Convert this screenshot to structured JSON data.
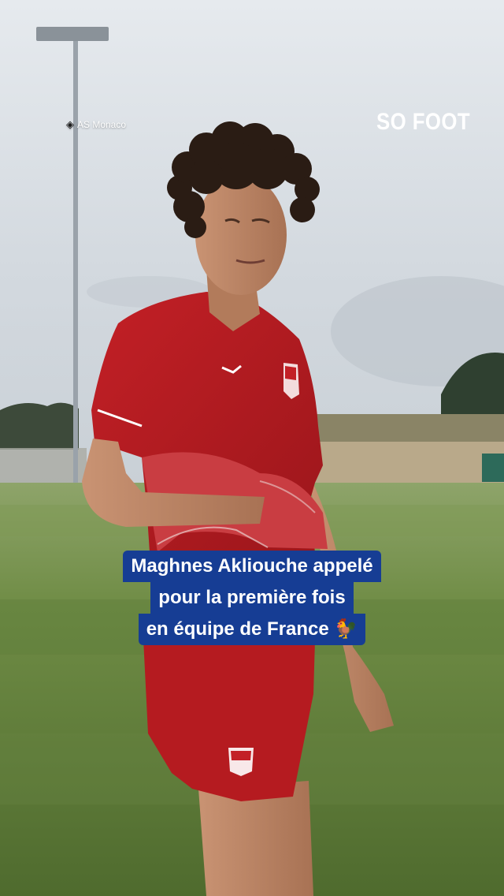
{
  "overlay": {
    "credit": "AS Monaco",
    "credit_icon": "camera-icon",
    "brand": "SO FOOT",
    "caption_lines": [
      "Maghnes Akliouche appelé",
      "pour la première fois",
      "en équipe de France 🐓"
    ]
  },
  "colors": {
    "caption_background": "#163d94",
    "shirt": "#b11a1f",
    "pitch": "#6e8c45",
    "sky": "#d9dfe5"
  }
}
